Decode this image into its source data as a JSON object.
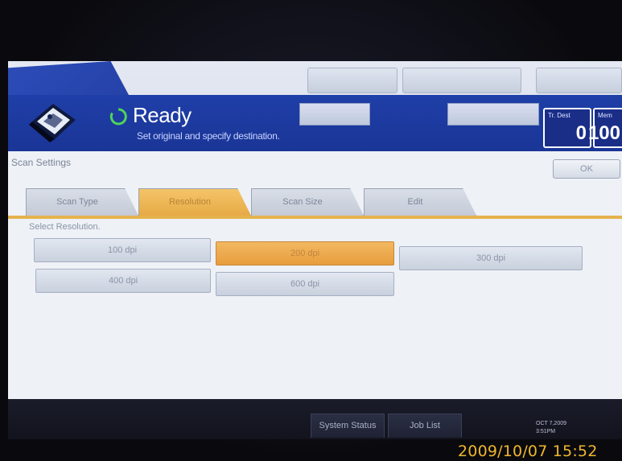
{
  "header": {
    "status_title": "Ready",
    "status_message": "Set original and specify destination.",
    "counters": [
      {
        "label": "Tr. Dest",
        "value": "0"
      },
      {
        "label": "Mem",
        "value": "100"
      }
    ],
    "icons": [
      "scanner-icon",
      "ready-status-icon"
    ]
  },
  "panel": {
    "title": "Scan Settings",
    "ok_label": "OK",
    "tabs": [
      {
        "label": "Scan Type",
        "selected": false
      },
      {
        "label": "Resolution",
        "selected": true
      },
      {
        "label": "Scan Size",
        "selected": false
      },
      {
        "label": "Edit",
        "selected": false
      }
    ],
    "instruction": "Select Resolution.",
    "resolutions": [
      {
        "label": "100 dpi",
        "selected": false
      },
      {
        "label": "200 dpi",
        "selected": true
      },
      {
        "label": "300 dpi",
        "selected": false
      },
      {
        "label": "400 dpi",
        "selected": false
      },
      {
        "label": "600 dpi",
        "selected": false
      }
    ]
  },
  "footer": {
    "system_status_label": "System Status",
    "job_list_label": "Job List",
    "device_date": "OCT  7,2009",
    "device_time": "3:51PM"
  },
  "photo_timestamp": "2009/10/07 15:52",
  "colors": {
    "header_blue": "#1f3fa8",
    "selected_orange": "#e79d3c",
    "timestamp_orange": "#f0b62e"
  }
}
